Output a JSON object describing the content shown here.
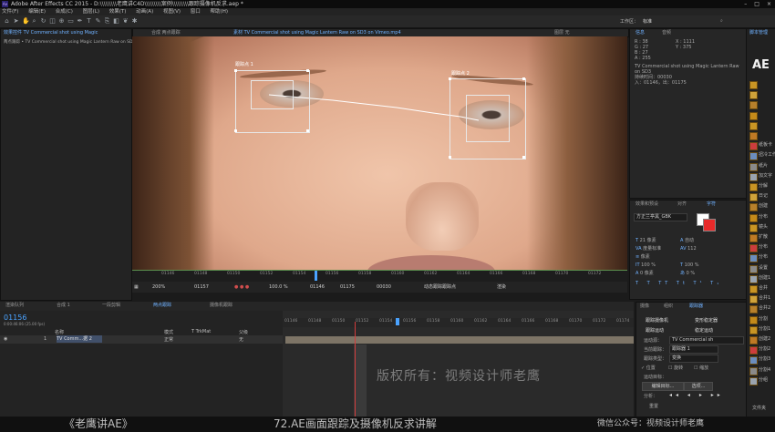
{
  "title": "Adobe After Effects CC 2015 - D:\\\\\\\\\\\\\\\\\\老鹰讲C4D\\\\\\\\\\\\\\\\\\案例\\\\\\\\\\\\\\\\\\跟踪摄像机反求.aep *",
  "menu": [
    "文件(F)",
    "编辑(E)",
    "合成(C)",
    "图层(L)",
    "效果(T)",
    "动画(A)",
    "视图(V)",
    "窗口",
    "帮助(H)"
  ],
  "toolbar": {
    "workspace_label": "工作区：",
    "workspace_value": "标准"
  },
  "left_panel": {
    "tab": "效果控件",
    "tab_file": "TV Commercial shot using Magic",
    "subtitle": "两点跟踪 • TV Commercial shot using Magic Lantern Raw on SD3"
  },
  "viewer": {
    "tab_comp": "合成 两点跟踪",
    "tab_footage": "素材 TV Commercial shot using Magic Lantern Raw on SD3 on Vimeo.mp4",
    "tab_layer": "图层 无",
    "track1_label": "跟踪点 1",
    "track2_label": "跟踪点 2",
    "ruler": [
      "01146",
      "01148",
      "01150",
      "01152",
      "01154",
      "01156",
      "01158",
      "01160",
      "01162",
      "01164",
      "01166",
      "01168",
      "01170",
      "01172",
      "01174"
    ],
    "zoom": "200%",
    "frame": "01157",
    "alpha": "100.0 %",
    "in_point": "01146",
    "out_point": "01175",
    "duration": "00030",
    "view_mode": "动态跟踪跟踪点",
    "render_label": "渲染"
  },
  "info": {
    "tab": "信息",
    "tab2": "音频",
    "r": "R : 38",
    "g": "G : 27",
    "b": "B : 27",
    "a": "A : 255",
    "x": "X : 1111",
    "y": "Y : 375",
    "clip": "TV Commercial shot using Magic Lantern Raw on SD3",
    "duration": "持续时间：00030",
    "inout": "入：01146，出：01175"
  },
  "character": {
    "tab1": "效果和预设",
    "tab2": "对齐",
    "tab3": "字符",
    "font": "方正兰亭黑_GBK",
    "size": "21 像素",
    "leading": "自动",
    "tracking": "度量标准",
    "kerning": "112",
    "stroke": "像素",
    "vscale": "100 %",
    "hscale": "100 %",
    "baseline": "0 像素",
    "tsume": "0 %"
  },
  "tracker": {
    "tabs": [
      "摄像",
      "组织",
      "跟踪器"
    ],
    "btn_track_camera": "跟踪摄像机",
    "btn_warp": "变形稳定器",
    "btn_track_motion": "跟踪运动",
    "btn_stabilize": "稳定运动",
    "source_label": "运动源：",
    "source_value": "TV Commercial sh",
    "current_label": "当前跟踪：",
    "current_value": "跟踪器 1",
    "type_label": "跟踪类型：",
    "type_value": "变换",
    "chk_position": "位置",
    "chk_rotation": "旋转",
    "chk_scale": "缩放",
    "target_label": "运动目标：",
    "edit_target": "编辑目标...",
    "options": "选项...",
    "analyze_label": "分析：",
    "reset": "重置"
  },
  "right_panel": {
    "tab": "脚本管理",
    "logo": "AE",
    "items": [
      "",
      "",
      "",
      "",
      "",
      "",
      "纸板卡",
      "扭冷工作",
      "纸片",
      "加文字",
      "分解",
      "日记",
      "创建",
      "分布",
      "镜头",
      "扩散",
      "分布",
      "分布",
      "设置",
      "创建1",
      "合并",
      "合并1",
      "合并2",
      "分割",
      "分割1",
      "创建2",
      "分割2",
      "分割3",
      "分割4",
      "分组"
    ],
    "footer": "文件夹"
  },
  "timeline": {
    "tabs": [
      "渲染队列",
      "合成 1",
      "一段剪辑",
      "两点跟踪",
      "摄像机跟踪"
    ],
    "current_time": "01156",
    "fps": "0:00:46:06 (25.00 fps)",
    "col_name": "名称",
    "col_mode": "模式",
    "col_trk": "T TrkMat",
    "col_parent": "父级",
    "layer_num": "1",
    "layer_name": "TV Comm...据 2",
    "layer_mode": "正常",
    "layer_parent": "无",
    "ruler": [
      "01146",
      "01148",
      "01150",
      "01152",
      "01154",
      "01156",
      "01158",
      "01160",
      "01162",
      "01164",
      "01166",
      "01168",
      "01170",
      "01172",
      "01174"
    ]
  },
  "watermark": "版权所有：视频设计师老鹰",
  "bottom": {
    "left": "《老鹰讲AE》",
    "center": "72.AE画面跟踪及摄像机反求讲解",
    "right": "微信公众号：视频设计师老鹰"
  }
}
